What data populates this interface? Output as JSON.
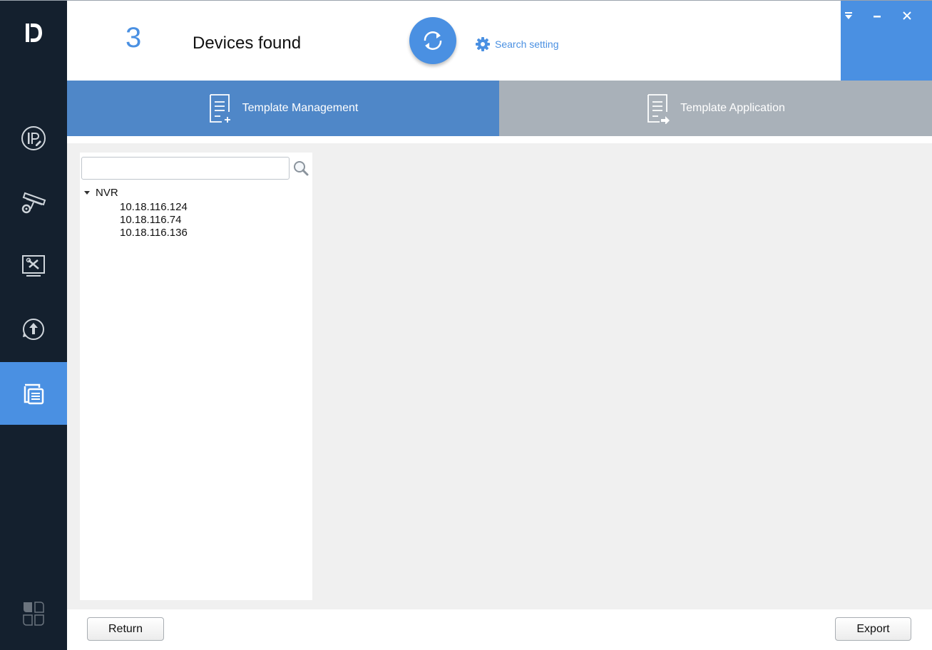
{
  "header": {
    "device_count": "3",
    "devices_found_label": "Devices found",
    "refresh_icon": "refresh-icon",
    "search_setting_label": "Search setting"
  },
  "window_controls": {
    "menu_icon": "dropdown-menu-icon",
    "minimize_icon": "minimize-icon",
    "close_icon": "close-icon"
  },
  "sidebar": {
    "logo_icon": "app-logo-icon",
    "items": [
      {
        "icon": "ip-modify-icon",
        "active": false
      },
      {
        "icon": "camera-settings-icon",
        "active": false
      },
      {
        "icon": "system-tools-icon",
        "active": false
      },
      {
        "icon": "upgrade-icon",
        "active": false
      },
      {
        "icon": "template-icon",
        "active": true
      }
    ],
    "bottom_icon": "apps-grid-icon"
  },
  "tabs": [
    {
      "label": "Template Management",
      "icon": "template-add-icon",
      "active": true
    },
    {
      "label": "Template Application",
      "icon": "template-apply-icon",
      "active": false
    }
  ],
  "tree": {
    "search_value": "",
    "root_label": "NVR",
    "children": [
      "10.18.116.124",
      "10.18.116.74",
      "10.18.116.136"
    ]
  },
  "footer": {
    "return_label": "Return",
    "export_label": "Export"
  },
  "colors": {
    "accent": "#4a90e2",
    "sidebar_bg": "#14202e",
    "tab_active": "#4f87c8",
    "tab_inactive": "#a9b1b9",
    "content_bg": "#f0f0f0"
  }
}
